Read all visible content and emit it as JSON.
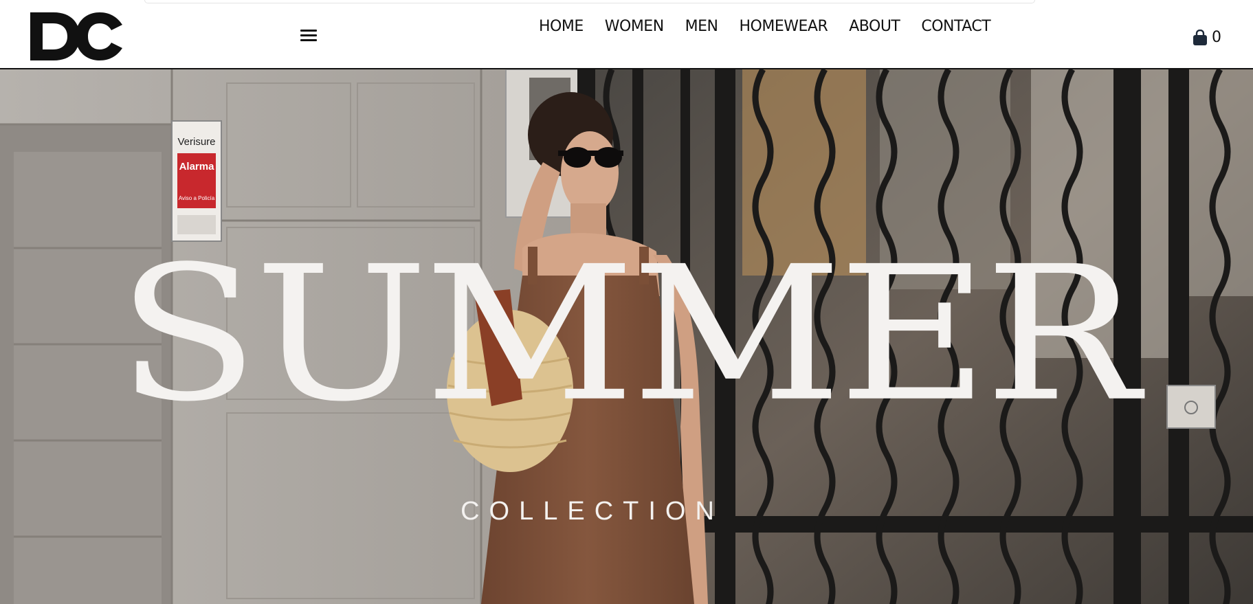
{
  "brand": {
    "logo_text": "DC"
  },
  "header": {
    "menu_icon": "hamburger-menu-icon",
    "nav": [
      "HOME",
      "WOMEN",
      "MEN",
      "HOMEWEAR",
      "ABOUT",
      "CONTACT"
    ],
    "cart": {
      "icon": "shopping-bag-icon",
      "count": "0"
    }
  },
  "hero": {
    "headline": "SUMMER",
    "subhead": "COLLECTION",
    "sign_text": [
      "Verisure",
      "Alarma",
      "Aviso a Policía"
    ]
  },
  "colors": {
    "text_light": "#f4f2f0",
    "dress": "#7b4f37",
    "stone": "#a8a49f",
    "iron": "#1b1a19"
  }
}
